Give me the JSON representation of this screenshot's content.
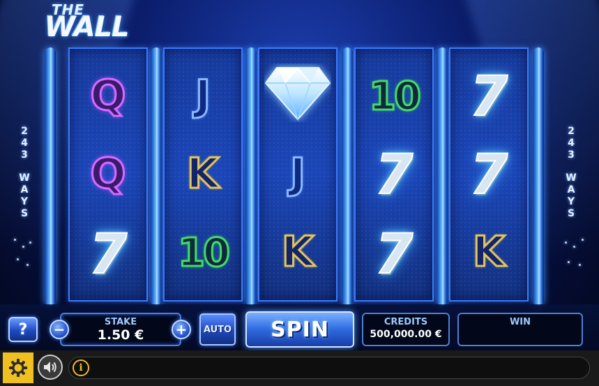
{
  "game": {
    "logo_the": "THE",
    "logo_wall": "WALL",
    "ways_left": [
      "2",
      "4",
      "3",
      "W",
      "A",
      "Y",
      "S"
    ],
    "ways_right": [
      "2",
      "4",
      "3",
      "W",
      "A",
      "Y",
      "S"
    ]
  },
  "reels": [
    {
      "symbols": [
        {
          "text": "Q",
          "kind": "queen-symbol"
        },
        {
          "text": "Q",
          "kind": "queen-symbol"
        },
        {
          "text": "7",
          "kind": "seven-symbol"
        }
      ]
    },
    {
      "symbols": [
        {
          "text": "J",
          "kind": "jack-symbol"
        },
        {
          "text": "K",
          "kind": "king-symbol"
        },
        {
          "text": "10",
          "kind": "ten-symbol"
        }
      ]
    },
    {
      "symbols": [
        {
          "text": "",
          "kind": "diamond-symbol"
        },
        {
          "text": "J",
          "kind": "jack-symbol"
        },
        {
          "text": "K",
          "kind": "king-symbol"
        }
      ]
    },
    {
      "symbols": [
        {
          "text": "10",
          "kind": "ten-symbol"
        },
        {
          "text": "7",
          "kind": "seven-symbol"
        },
        {
          "text": "7",
          "kind": "seven-symbol"
        }
      ]
    },
    {
      "symbols": [
        {
          "text": "7",
          "kind": "seven-symbol"
        },
        {
          "text": "7",
          "kind": "seven-symbol"
        },
        {
          "text": "K",
          "kind": "king-symbol"
        }
      ]
    }
  ],
  "controls": {
    "help_label": "?",
    "minus_label": "−",
    "plus_label": "+",
    "stake_label": "STAKE",
    "stake_value": "1.50 €",
    "auto_label": "AUTO",
    "spin_label": "SPIN",
    "credits_label": "CREDITS",
    "credits_value": "500,000.00 €",
    "win_label": "WIN",
    "win_value": ""
  },
  "bottom": {
    "info_icon": "i",
    "settings_icon": "gear-icon",
    "sound_icon": "speaker-icon"
  },
  "colors": {
    "accent_yellow": "#f0c020",
    "reel_border": "#3a7aff",
    "panel_label": "#9ec8ff"
  }
}
